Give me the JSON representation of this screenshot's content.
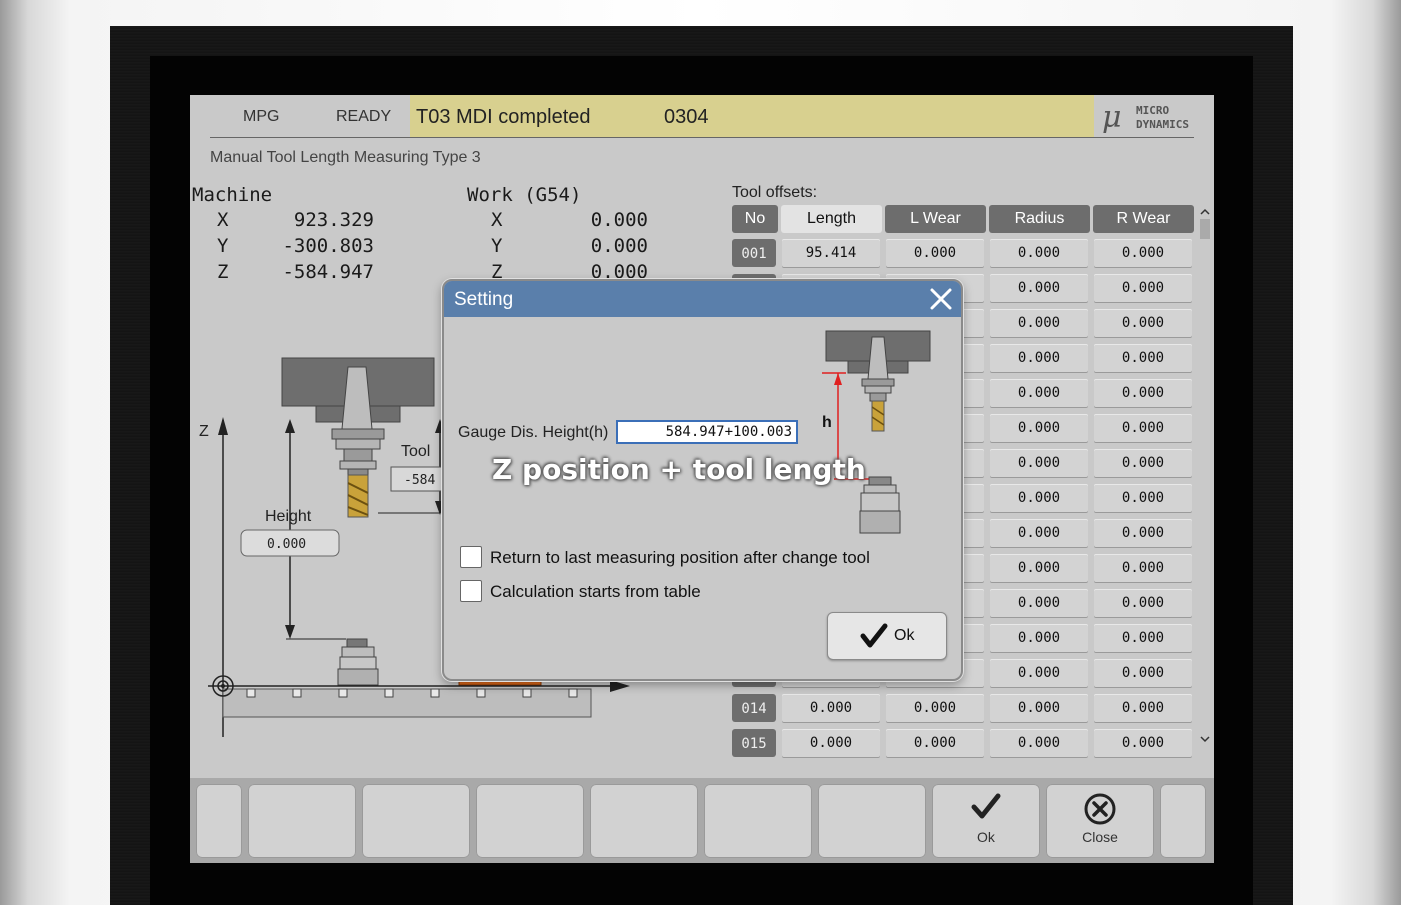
{
  "status": {
    "mode": "MPG",
    "state": "READY",
    "tool": "T03",
    "message": "MDI completed",
    "program": "0304",
    "logo_text": [
      "MICRO",
      "DYNAMICS"
    ]
  },
  "subtitle": "Manual Tool Length Measuring Type 3",
  "machine": {
    "title": "Machine",
    "axes": [
      {
        "axis": "X",
        "value": "923.329"
      },
      {
        "axis": "Y",
        "value": "-300.803"
      },
      {
        "axis": "Z",
        "value": "-584.947"
      }
    ]
  },
  "work": {
    "title": "Work (G54)",
    "axes": [
      {
        "axis": "X",
        "value": "0.000"
      },
      {
        "axis": "Y",
        "value": "0.000"
      },
      {
        "axis": "Z",
        "value": "0.000"
      }
    ]
  },
  "diagram": {
    "z_label": "Z",
    "tool_label": "Tool",
    "tool_value": "-584",
    "height_label": "Height",
    "height_value": "0.000"
  },
  "offsets": {
    "title": "Tool offsets:",
    "columns": [
      "No",
      "Length",
      "L Wear",
      "Radius",
      "R Wear"
    ],
    "rows": [
      {
        "no": "001",
        "length": "95.414",
        "lwear": "0.000",
        "radius": "0.000",
        "rwear": "0.000"
      },
      {
        "no": "",
        "length": "",
        "lwear": "0",
        "radius": "0.000",
        "rwear": "0.000"
      },
      {
        "no": "",
        "length": "",
        "lwear": "0",
        "radius": "0.000",
        "rwear": "0.000"
      },
      {
        "no": "",
        "length": "",
        "lwear": "0",
        "radius": "0.000",
        "rwear": "0.000"
      },
      {
        "no": "",
        "length": "",
        "lwear": "0",
        "radius": "0.000",
        "rwear": "0.000"
      },
      {
        "no": "",
        "length": "",
        "lwear": "0",
        "radius": "0.000",
        "rwear": "0.000"
      },
      {
        "no": "",
        "length": "",
        "lwear": "0",
        "radius": "0.000",
        "rwear": "0.000"
      },
      {
        "no": "",
        "length": "",
        "lwear": "0",
        "radius": "0.000",
        "rwear": "0.000"
      },
      {
        "no": "",
        "length": "",
        "lwear": "0",
        "radius": "0.000",
        "rwear": "0.000"
      },
      {
        "no": "",
        "length": "",
        "lwear": "0",
        "radius": "0.000",
        "rwear": "0.000"
      },
      {
        "no": "",
        "length": "",
        "lwear": "0",
        "radius": "0.000",
        "rwear": "0.000"
      },
      {
        "no": "",
        "length": "",
        "lwear": "0",
        "radius": "0.000",
        "rwear": "0.000"
      },
      {
        "no": "",
        "length": "",
        "lwear": "0",
        "radius": "0.000",
        "rwear": "0.000"
      },
      {
        "no": "014",
        "length": "0.000",
        "lwear": "0.000",
        "radius": "0.000",
        "rwear": "0.000"
      },
      {
        "no": "015",
        "length": "0.000",
        "lwear": "0.000",
        "radius": "0.000",
        "rwear": "0.000"
      }
    ]
  },
  "softkeys": [
    {
      "label": "",
      "icon": ""
    },
    {
      "label": "",
      "icon": ""
    },
    {
      "label": "",
      "icon": ""
    },
    {
      "label": "",
      "icon": ""
    },
    {
      "label": "",
      "icon": ""
    },
    {
      "label": "",
      "icon": ""
    },
    {
      "label": "",
      "icon": ""
    },
    {
      "label": "Ok",
      "icon": "checkmark-icon"
    },
    {
      "label": "Close",
      "icon": "close-circle-icon"
    },
    {
      "label": "",
      "icon": ""
    }
  ],
  "dialog": {
    "title": "Setting",
    "gauge_label": "Gauge Dis. Height(h)",
    "gauge_value": "584.947+100.003",
    "h_label": "h",
    "overlay_text": "Z position + tool length",
    "checkbox1_label": "Return to last measuring position after change tool",
    "checkbox1_checked": false,
    "checkbox2_label": "Calculation starts from table",
    "checkbox2_checked": false,
    "ok_label": "Ok"
  },
  "colors": {
    "status_highlight": "#d8d08f",
    "dialog_title": "#5a7fab",
    "table_header": "#6d6d6d",
    "height_arrow": "#e02020",
    "tool_flute": "#c9a23a",
    "workpiece": "#e06a1a"
  }
}
